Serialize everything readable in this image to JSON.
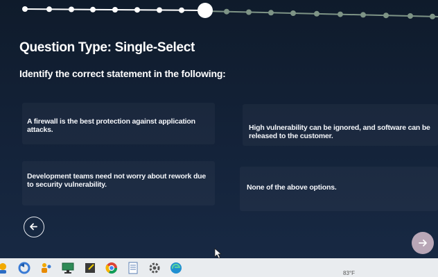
{
  "quiz": {
    "total_steps": 19,
    "current_step": 9,
    "title": "Question Type: Single-Select",
    "question": "Identify the correct statement in the following:",
    "options": [
      {
        "label": "A firewall is the best protection against application attacks."
      },
      {
        "label": "High vulnerability can be ignored, and software can be released to the customer."
      },
      {
        "label": "Development teams need not worry about rework due to security vulnerability."
      },
      {
        "label": "None of the above options."
      }
    ]
  },
  "navigation": {
    "back_icon": "arrow-left-icon",
    "next_icon": "arrow-right-icon"
  },
  "taskbar": {
    "weather_temp": "83°F",
    "icons": [
      "account-icon",
      "settings-sync-icon",
      "people-icon",
      "monitor-icon",
      "notes-icon",
      "chrome-icon",
      "document-icon",
      "gear-icon",
      "edge-icon"
    ]
  },
  "colors": {
    "progress_done": "#ffffff",
    "progress_todo": "#7e9486",
    "next_button": "#b9a7b7",
    "background": "#14233a"
  }
}
